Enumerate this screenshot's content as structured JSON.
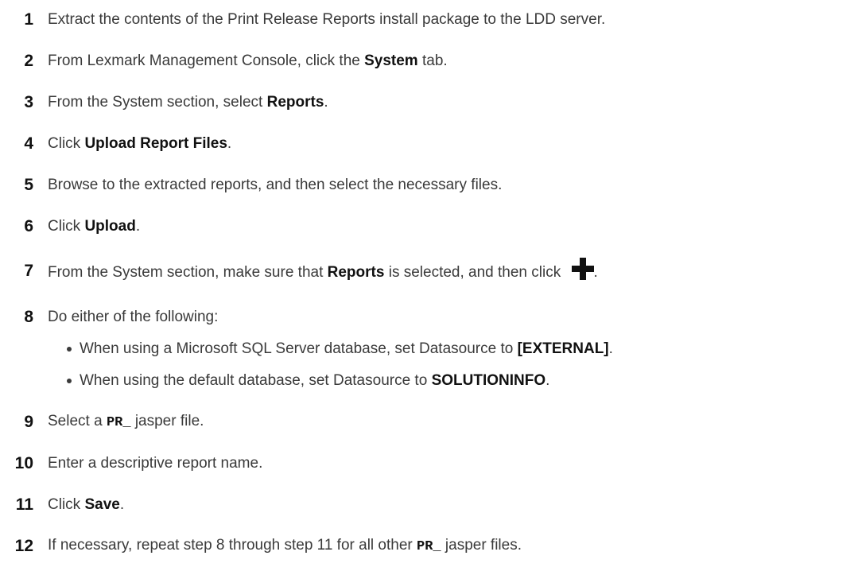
{
  "steps": [
    {
      "n": "1",
      "parts": [
        "Extract the contents of the Print Release Reports install package to the LDD server."
      ]
    },
    {
      "n": "2",
      "pre": "From Lexmark Management Console, click the ",
      "bold": "System",
      "post": " tab."
    },
    {
      "n": "3",
      "pre": "From the System section, select ",
      "bold": "Reports",
      "post": "."
    },
    {
      "n": "4",
      "pre": "Click ",
      "bold": "Upload Report Files",
      "post": "."
    },
    {
      "n": "5",
      "parts": [
        "Browse to the extracted reports, and then select the necessary files."
      ]
    },
    {
      "n": "6",
      "pre": "Click ",
      "bold": "Upload",
      "post": "."
    },
    {
      "n": "7",
      "pre": "From the System section, make sure that ",
      "bold": "Reports",
      "mid": " is selected, and then click ",
      "post": ".",
      "icon": "plus-icon"
    },
    {
      "n": "8",
      "parts": [
        "Do either of the following:"
      ]
    },
    {
      "n": "9",
      "pre": "Select a ",
      "code": "PR_",
      "post": " jasper file."
    },
    {
      "n": "10",
      "parts": [
        "Enter a descriptive report name."
      ]
    },
    {
      "n": "11",
      "pre": "Click ",
      "bold": "Save",
      "post": "."
    },
    {
      "n": "12",
      "pre": "If necessary, repeat step 8 through step 11 for all other ",
      "code": "PR_",
      "post": " jasper files."
    }
  ],
  "bullets": [
    {
      "pre": "When using a Microsoft SQL Server database, set Datasource to ",
      "bold": "[EXTERNAL]",
      "post": "."
    },
    {
      "pre": "When using the default database, set Datasource to ",
      "bold": "SOLUTIONINFO",
      "post": "."
    }
  ]
}
